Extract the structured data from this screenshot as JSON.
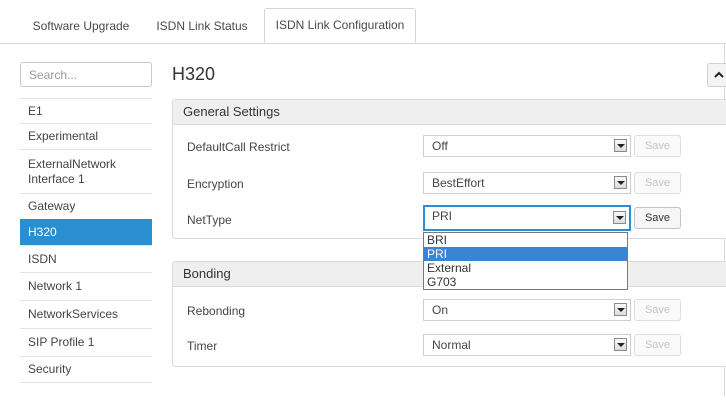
{
  "tabs": [
    {
      "label": "Software Upgrade"
    },
    {
      "label": "ISDN Link Status"
    },
    {
      "label": "ISDN Link Configuration"
    }
  ],
  "search": {
    "placeholder": "Search..."
  },
  "sidebar": {
    "items": [
      {
        "label": "E1"
      },
      {
        "label": "Experimental"
      },
      {
        "label": "ExternalNetwork Interface 1"
      },
      {
        "label": "Gateway"
      },
      {
        "label": "H320"
      },
      {
        "label": "ISDN"
      },
      {
        "label": "Network 1"
      },
      {
        "label": "NetworkServices"
      },
      {
        "label": "SIP Profile 1"
      },
      {
        "label": "Security"
      }
    ],
    "selected": "H320"
  },
  "page": {
    "title": "H320",
    "collapse_icon": "chevron-up-icon"
  },
  "general": {
    "heading": "General Settings",
    "rows": [
      {
        "label": "DefaultCall Restrict",
        "value": "Off",
        "save": "Save"
      },
      {
        "label": "Encryption",
        "value": "BestEffort",
        "save": "Save"
      },
      {
        "label": "NetType",
        "value": "PRI",
        "save": "Save"
      }
    ]
  },
  "nettype_dropdown": {
    "options": [
      "BRI",
      "PRI",
      "External",
      "G703"
    ],
    "selected": "PRI"
  },
  "bonding": {
    "heading": "Bonding",
    "rows": [
      {
        "label": "Rebonding",
        "value": "On",
        "save": "Save"
      },
      {
        "label": "Timer",
        "value": "Normal",
        "save": "Save"
      }
    ]
  },
  "colors": {
    "accent": "#2a8fd0",
    "selected_option": "#3a84d4"
  }
}
